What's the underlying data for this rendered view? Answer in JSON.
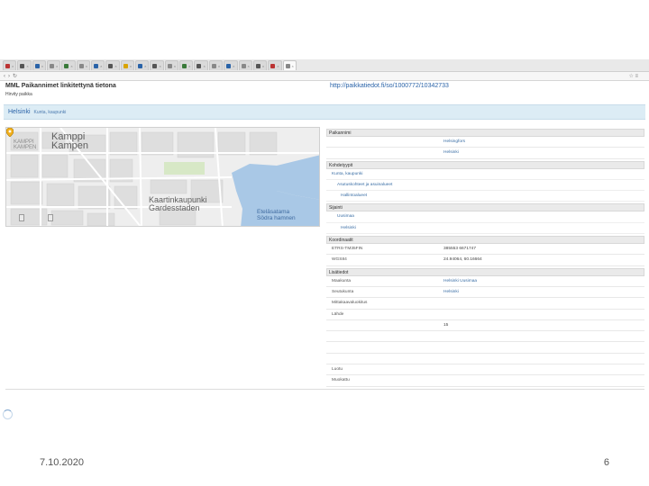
{
  "browser": {
    "tabs": [
      {
        "label": "",
        "color": "#b33"
      },
      {
        "label": "",
        "color": "#555"
      },
      {
        "label": "",
        "color": "#2a63a8"
      },
      {
        "label": "",
        "color": "#888"
      },
      {
        "label": "",
        "color": "#3a7a3a"
      },
      {
        "label": "",
        "color": "#888"
      },
      {
        "label": "",
        "color": "#2a63a8"
      },
      {
        "label": "",
        "color": "#555"
      },
      {
        "label": "",
        "color": "#d9a400"
      },
      {
        "label": "",
        "color": "#2a63a8"
      },
      {
        "label": "",
        "color": "#555"
      },
      {
        "label": "",
        "color": "#888"
      },
      {
        "label": "",
        "color": "#3a7a3a"
      },
      {
        "label": "",
        "color": "#555"
      },
      {
        "label": "",
        "color": "#888"
      },
      {
        "label": "",
        "color": "#2a63a8"
      },
      {
        "label": "",
        "color": "#888"
      },
      {
        "label": "",
        "color": "#555"
      },
      {
        "label": "",
        "color": "#b33"
      },
      {
        "label": "",
        "color": "#888",
        "active": true
      }
    ],
    "url": "",
    "icons": {
      "back": "back-arrow-icon",
      "forward": "forward-arrow-icon",
      "reload": "reload-icon",
      "star": "star-icon",
      "menu": "menu-icon"
    }
  },
  "page": {
    "title": "MML Paikannimet linkitettynä tietona",
    "title_note": "",
    "breadcrumb": "Hirvity paikka",
    "permalink": "http://paikkatiedot.fi/so/1000772/10342733"
  },
  "band": {
    "title": "Helsinki",
    "subtitle": "Kunta, kaupunki"
  },
  "map": {
    "labels": {
      "kamppi": "Kamppi\nKampen",
      "kamppi_small": "KAMPPI\nKAMPEN",
      "kaarti": "Kaartinkaupunki\nGardesstaden",
      "etela": "Eteläsatama\nSödra hamnen",
      "street": ""
    },
    "buttons": [
      "",
      ""
    ],
    "zoom": ""
  },
  "info": {
    "sec_name": "Paikannimi",
    "names": [
      {
        "k": "",
        "v": "Helsingfors"
      },
      {
        "k": "",
        "v": "Helsinki"
      }
    ],
    "sec_kohdetyyppi": "Kohdetyypit",
    "kohdetyypit": [
      "Kunta, kaupunki",
      "Asutuskohteet ja asuinalueet",
      "Hallintoalueet"
    ],
    "sec_sijainti": "Sijainti",
    "sijainti": [
      "Uusimaa",
      "Helsinki"
    ],
    "sec_koord": "Koordinaatit",
    "koord": [
      {
        "k": "ETRS-TM35FIN",
        "v": "385553 6671747"
      },
      {
        "k": "WGS84",
        "v": "24.94064, 60.16664"
      }
    ],
    "sec_lisatiedot": "Lisätiedot",
    "lisatiedot": [
      {
        "k": "Maakunta",
        "v": "Helsinki Uusimaa",
        "link": true
      },
      {
        "k": "Seutukunta",
        "v": "Helsinki",
        "link": true
      },
      {
        "k": "Mittakaavaluokitus",
        "v": "",
        "link": true
      },
      {
        "k": "Lähde",
        "v": "",
        "link": true
      },
      {
        "k": "",
        "v": "15",
        "link": false
      },
      {
        "k": "",
        "v": "",
        "link": false
      },
      {
        "k": "",
        "v": "",
        "link": false
      },
      {
        "k": "",
        "v": "",
        "link": false
      },
      {
        "k": "Luotu",
        "v": "",
        "link": false
      },
      {
        "k": "Muokattu",
        "v": "",
        "link": false
      }
    ]
  },
  "footer": {
    "label": "",
    "formats": [
      "",
      "",
      "",
      "",
      ""
    ],
    "right": ""
  },
  "slide": {
    "date": "7.10.2020",
    "number": "6"
  }
}
